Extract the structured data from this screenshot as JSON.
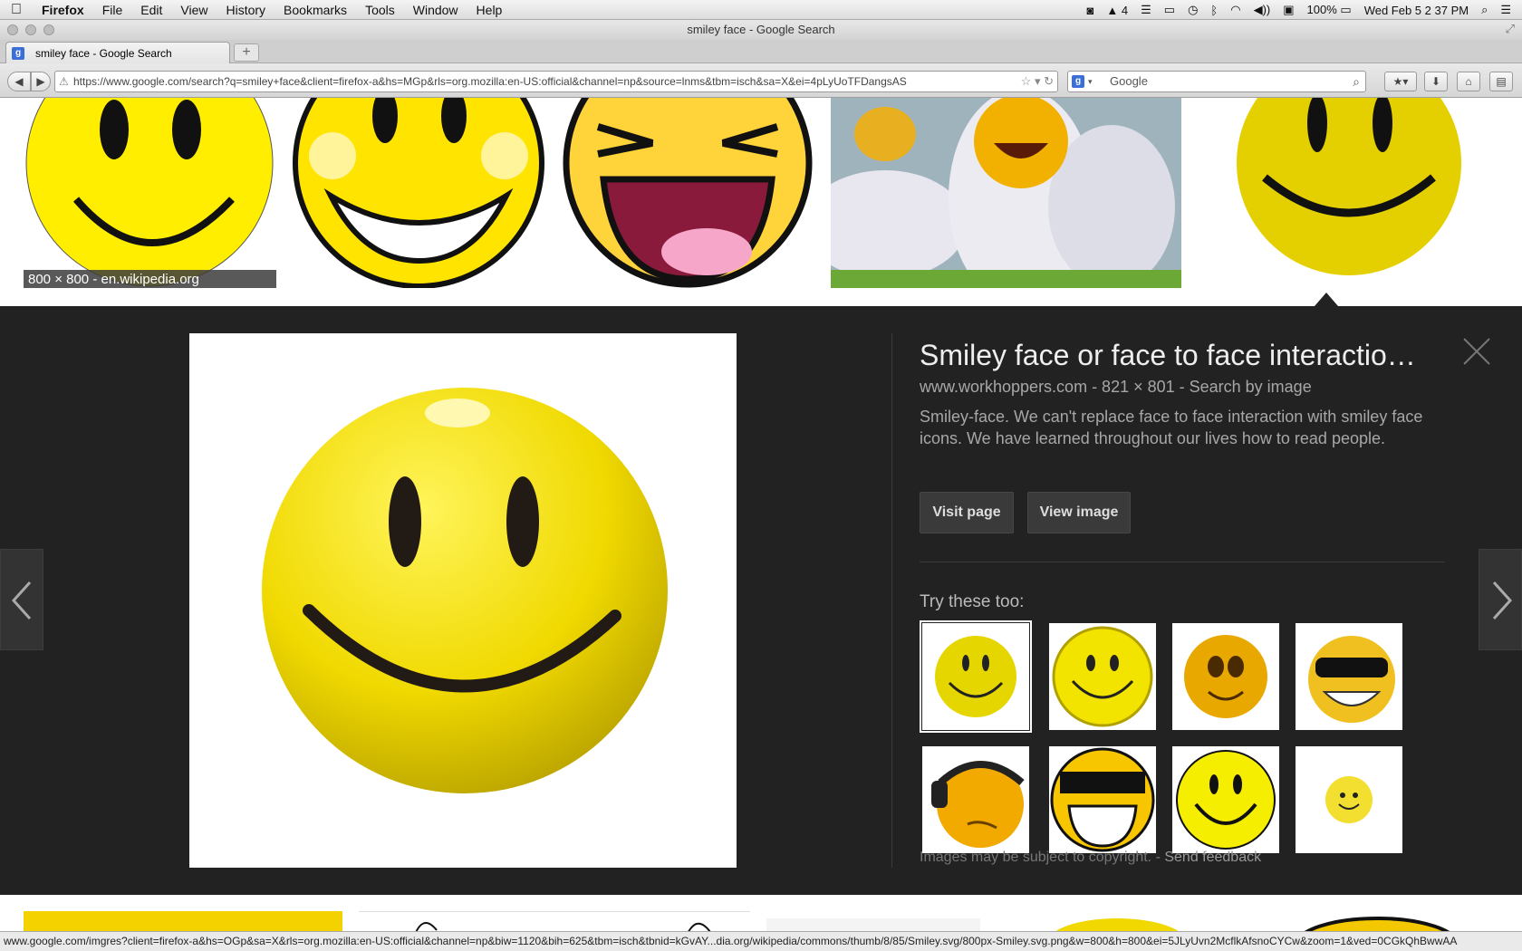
{
  "menubar": {
    "app": "Firefox",
    "items": [
      "File",
      "Edit",
      "View",
      "History",
      "Bookmarks",
      "Tools",
      "Window",
      "Help"
    ],
    "status_number": "4",
    "battery": "100%",
    "clock": "Wed Feb 5  2 37 PM"
  },
  "window": {
    "title": "smiley face - Google Search"
  },
  "tab": {
    "label": "smiley face - Google Search",
    "new_tab": "+"
  },
  "nav": {
    "url": "https://www.google.com/search?q=smiley+face&client=firefox-a&hs=MGp&rls=org.mozilla:en-US:official&channel=np&source=lnms&tbm=isch&sa=X&ei=4pLyUoTFDangsAS",
    "search_placeholder": "Google"
  },
  "results": {
    "first_label": "800 × 800 - en.wikipedia.org"
  },
  "preview": {
    "title": "Smiley face or face to face interactio…",
    "meta": "www.workhoppers.com - 821 × 801 - Search by image",
    "description": "Smiley-face. We can't replace face to face interaction with smiley face icons. We have learned throughout our lives how to read people.",
    "visit_button": "Visit page",
    "view_button": "View image",
    "try_label": "Try these too:",
    "copyright": "Images may be subject to copyright.",
    "copyright_sep": " - ",
    "feedback": "Send feedback"
  },
  "status_url": "www.google.com/imgres?client=firefox-a&hs=OGp&sa=X&rls=org.mozilla:en-US:official&channel=np&biw=1120&bih=625&tbm=isch&tbnid=kGvAY...dia.org/wikipedia/commons/thumb/8/85/Smiley.svg/800px-Smiley.svg.png&w=800&h=800&ei=5JLyUvn2McflkAfsnoCYCw&zoom=1&ved=0CGkQhBwwAA",
  "colors": {
    "panel": "#222222",
    "smiley_yellow": "#f5e000",
    "accent_blue": "#3b6fd8"
  },
  "icons": [
    "apple-icon",
    "back-icon",
    "forward-icon",
    "reload-icon",
    "star-icon",
    "search-icon",
    "download-icon",
    "home-icon",
    "close-icon",
    "prev-arrow-icon",
    "next-arrow-icon"
  ]
}
